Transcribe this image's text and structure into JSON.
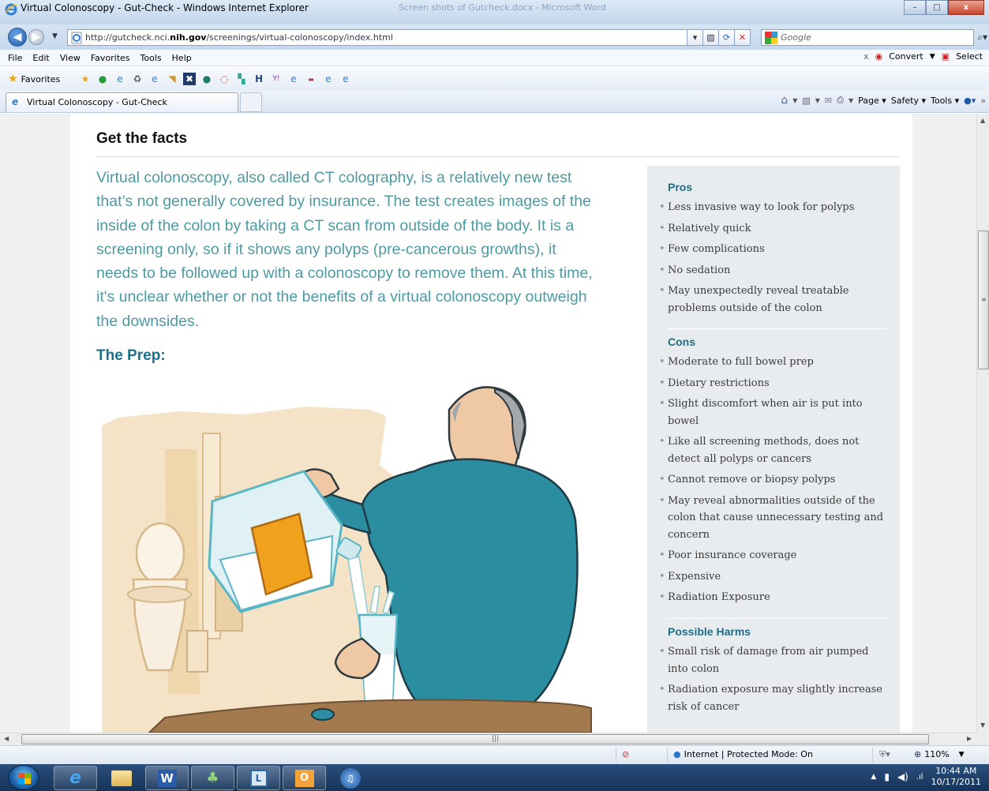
{
  "window": {
    "title": "Virtual Colonoscopy - Gut-Check - Windows Internet Explorer",
    "background_title": "Screen shots of Gutcheck.docx - Microsoft Word",
    "minimize": "–",
    "maximize": "□",
    "close": "x"
  },
  "address": {
    "url_prefix": "http://gutcheck.nci.",
    "url_host": "nih.gov",
    "url_suffix": "/screenings/virtual-colonoscopy/index.html",
    "search_label": "Google"
  },
  "menu": {
    "items": [
      "File",
      "Edit",
      "View",
      "Favorites",
      "Tools",
      "Help"
    ],
    "close_x": "x",
    "convert_label": "Convert",
    "select_label": "Select"
  },
  "favorites": {
    "label": "Favorites"
  },
  "tabs": {
    "active_title": "Virtual Colonoscopy - Gut-Check"
  },
  "commandbar": {
    "page_label": "Page",
    "safety_label": "Safety",
    "tools_label": "Tools"
  },
  "content": {
    "heading": "Get the facts",
    "intro": "Virtual colonoscopy, also called CT colography, is a relatively new test that’s not generally covered by insurance. The test creates images of the inside of the colon by taking a CT scan from outside of the body. It is a screening only, so if it shows any polyps (pre-cancerous growths), it needs to be followed up with a colonoscopy to remove them. At this time, it's unclear whether or not the benefits of a virtual colonoscopy outweigh the downsides.",
    "prep_heading": "The Prep:"
  },
  "sidebar": {
    "pros_heading": "Pros",
    "pros": [
      "Less invasive way to look for polyps",
      "Relatively quick",
      "Few complications",
      "No sedation",
      "May unexpectedly reveal treatable problems outside of the colon"
    ],
    "cons_heading": "Cons",
    "cons": [
      "Moderate to full bowel prep",
      "Dietary restrictions",
      "Slight discomfort when air is put into bowel",
      "Like all screening methods, does not detect all polyps or cancers",
      "Cannot remove or biopsy polyps",
      "May reveal abnormalities outside of the colon that cause unnecessary testing and concern",
      "Poor insurance coverage",
      "Expensive",
      "Radiation Exposure"
    ],
    "harms_heading": "Possible Harms",
    "harms": [
      "Small risk of damage from air pumped into colon",
      "Radiation exposure may slightly increase risk of cancer"
    ]
  },
  "statusbar": {
    "zone": "Internet | Protected Mode: On",
    "zoom": "110%"
  },
  "taskbar": {
    "time": "10:44 AM",
    "date": "10/17/2011"
  },
  "colors": {
    "intro_text": "#4e9aa3",
    "heading_teal": "#1d6f86",
    "sidebar_bg": "#e8ecef",
    "taskbar": "#1f4068"
  }
}
